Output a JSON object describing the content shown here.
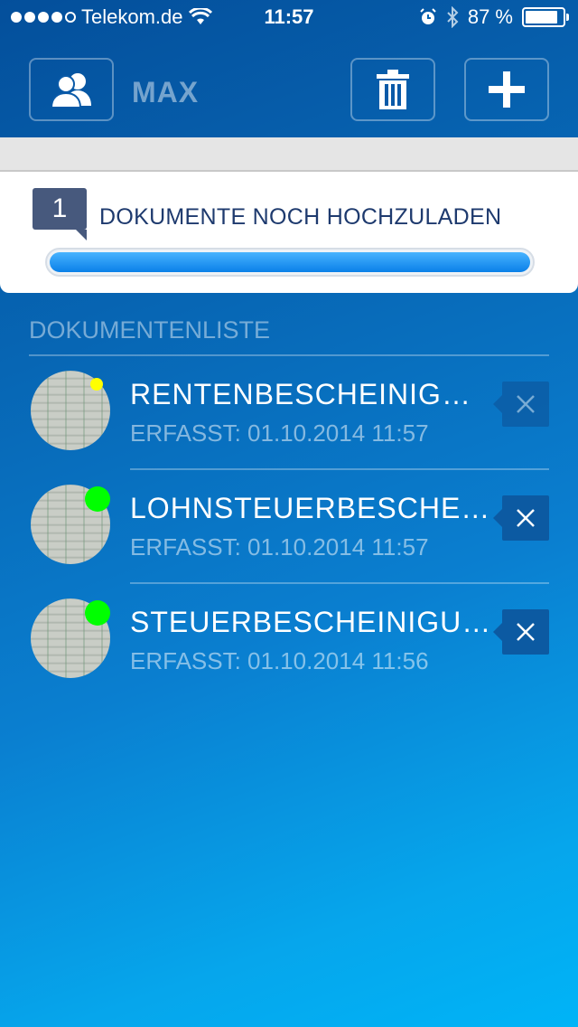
{
  "status_bar": {
    "carrier": "Telekom.de",
    "time": "11:57",
    "battery_text": "87 %",
    "battery_level": 0.87,
    "signal_bars": 4
  },
  "header": {
    "user_name": "MAX",
    "icons": {
      "profile": "users-icon",
      "trash": "trash-icon",
      "add": "plus-icon"
    }
  },
  "upload": {
    "count": "1",
    "text": "DOKUMENTE NOCH HOCHZULADEN",
    "progress": 1.0
  },
  "list": {
    "title": "DOKUMENTENLISTE",
    "items": [
      {
        "title": "RENTENBESCHEINIG…",
        "date": "ERFASST: 01.10.2014 11:57",
        "status_color": "#ffff00",
        "status": "pending"
      },
      {
        "title": "LOHNSTEUERBESCHE…",
        "date": "ERFASST: 01.10.2014 11:57",
        "status_color": "#00ff00",
        "status": "uploaded"
      },
      {
        "title": "STEUERBESCHEINIGU…",
        "date": "ERFASST: 01.10.2014 11:56",
        "status_color": "#00ff00",
        "status": "uploaded"
      }
    ]
  }
}
